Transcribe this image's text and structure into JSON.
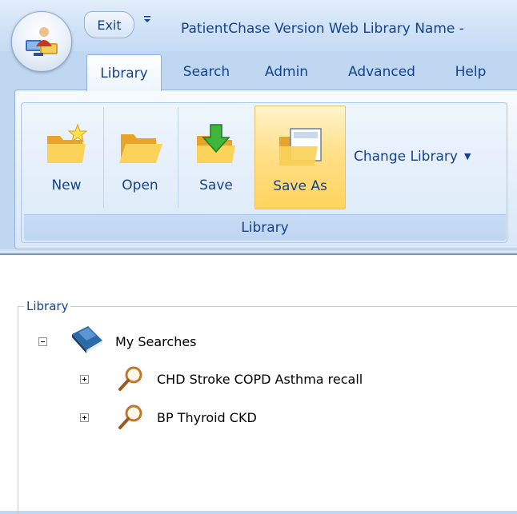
{
  "window": {
    "title": "PatientChase Version Web  Library Name -",
    "exit_label": "Exit",
    "qat_dropdown_glyph": "≡"
  },
  "tabs": [
    {
      "label": "Library",
      "active": true
    },
    {
      "label": "Search",
      "active": false
    },
    {
      "label": "Admin",
      "active": false
    },
    {
      "label": "Advanced",
      "active": false
    },
    {
      "label": "Help",
      "active": false
    }
  ],
  "ribbon": {
    "group_label": "Library",
    "buttons": [
      {
        "label": "New",
        "icon": "new-folder-icon"
      },
      {
        "label": "Open",
        "icon": "open-folder-icon"
      },
      {
        "label": "Save",
        "icon": "save-icon"
      },
      {
        "label": "Save As",
        "icon": "save-as-icon",
        "highlighted": true
      }
    ],
    "change_library_label": "Change Library",
    "change_library_caret": "▼"
  },
  "library_panel": {
    "legend": "Library",
    "root": {
      "label": "My Searches",
      "expanded": true,
      "icon": "book-icon"
    },
    "children": [
      {
        "label": "CHD Stroke COPD Asthma recall",
        "expanded": false,
        "icon": "magnifier-icon"
      },
      {
        "label": "BP Thyroid CKD",
        "expanded": false,
        "icon": "magnifier-icon"
      }
    ]
  },
  "colors": {
    "ribbon_text": "#15428b",
    "highlight": "#ffd45e",
    "frame": "#bfd7f1"
  }
}
